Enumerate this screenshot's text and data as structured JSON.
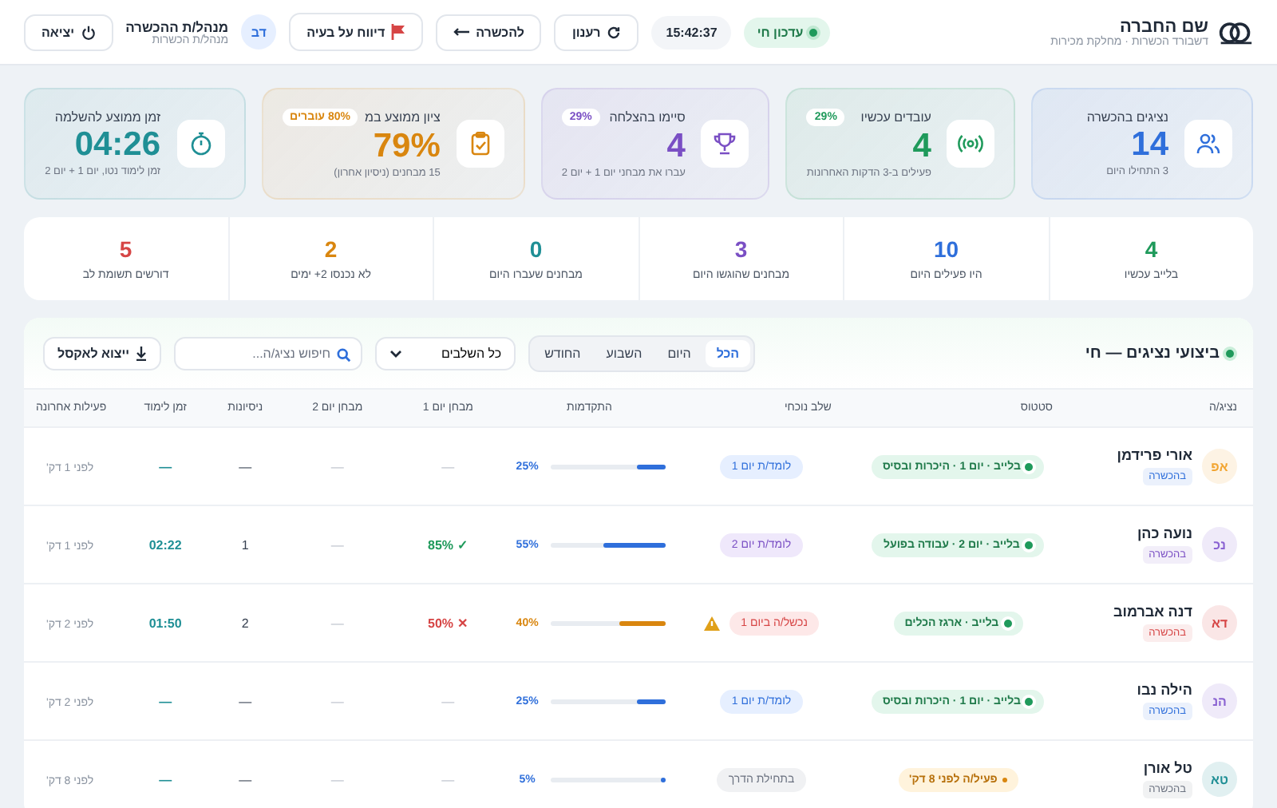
{
  "header": {
    "company": "שם החברה",
    "subtitle": "דשבורד הכשרות · מחלקת מכירות",
    "live_label": "עדכון חי",
    "clock": "15:42:37",
    "refresh": "רענון",
    "to_training": "להכשרה",
    "report": "דיווח על בעיה",
    "user_initials": "דב",
    "user_name": "מנהל/ת ההכשרה",
    "user_role": "מנהל/ת הכשרות",
    "logout": "יציאה"
  },
  "stat_cards": [
    {
      "kind": "people",
      "color": "#2f6fdb",
      "title": "נציגים בהכשרה",
      "value": "14",
      "note": "3 התחילו היום"
    },
    {
      "kind": "signal",
      "color": "#1f9a5b",
      "title": "עובדים עכשיו",
      "value": "4",
      "note": "פעילים ב-3 הדקות האחרונות",
      "badge": "29%"
    },
    {
      "kind": "trophy",
      "color": "#7a4fc4",
      "title": "סיימו בהצלחה",
      "value": "4",
      "note": "עברו את מבחני יום 1 + יום 2",
      "badge": "29%"
    },
    {
      "kind": "clipboard",
      "color": "#d9860f",
      "title": "ציון ממוצע במ",
      "value": "79%",
      "note": "15 מבחנים (ניסיון אחרון)",
      "badge": "80% עוברים"
    },
    {
      "kind": "timer",
      "color": "#1f8f95",
      "title": "זמן ממוצע להשלמה",
      "value": "04:26",
      "note": "זמן לימוד נטו, יום 1 + יום 2"
    }
  ],
  "counters": [
    {
      "value": "4",
      "label": "בלייב עכשיו",
      "color": "#1f9a5b"
    },
    {
      "value": "10",
      "label": "היו פעילים היום",
      "color": "#2f6fdb"
    },
    {
      "value": "3",
      "label": "מבחנים שהוגשו היום",
      "color": "#7a4fc4"
    },
    {
      "value": "0",
      "label": "מבחנים שעברו היום",
      "color": "#1f8f95"
    },
    {
      "value": "2",
      "label": "לא נכנסו 2+ ימים",
      "color": "#d9860f"
    },
    {
      "value": "5",
      "label": "דורשים תשומת לב",
      "color": "#d64545"
    }
  ],
  "table": {
    "title": "ביצועי נציגים — חי",
    "periods": [
      {
        "label": "הכל",
        "selected": true
      },
      {
        "label": "היום",
        "selected": false
      },
      {
        "label": "השבוע",
        "selected": false
      },
      {
        "label": "החודש",
        "selected": false
      }
    ],
    "stage_filter": "כל השלבים",
    "search": {
      "placeholder": "חיפוש נציג/ה..."
    },
    "export": "ייצוא לאקסל",
    "columns": [
      "נציג/ה",
      "סטטוס",
      "שלב נוכחי",
      "התקדמות",
      "מבחן יום 1",
      "מבחן יום 2",
      "ניסיונות",
      "זמן לימוד",
      "פעילות אחרונה"
    ],
    "rows": [
      {
        "initials": "אפ",
        "color": "#f2a531",
        "name": "אורי פרידמן",
        "tag": {
          "text": "בהכשרה",
          "color": "#2f6fdb"
        },
        "status": {
          "kind": "live",
          "text": "בלייב · יום 1 · היכרות ובסיס"
        },
        "stage": {
          "kind": "day1",
          "text": "לומד/ת יום 1"
        },
        "progress": {
          "level": 0.25,
          "text": "25%"
        },
        "test1": {
          "kind": "none",
          "text": "—"
        },
        "test2": {
          "kind": "none",
          "text": "—"
        },
        "attempts": "—",
        "time": "—",
        "last": "לפני 1 דק'"
      },
      {
        "initials": "נכ",
        "color": "#8a63d2",
        "name": "נועה כהן",
        "tag": {
          "text": "בהכשרה",
          "color": "#7a4fc4"
        },
        "status": {
          "kind": "live",
          "text": "בלייב · יום 2 · עבודה בפועל"
        },
        "stage": {
          "kind": "day2",
          "text": "לומד/ת יום 2"
        },
        "progress": {
          "level": 0.55,
          "text": "55%"
        },
        "test1": {
          "kind": "pass",
          "text": "✓ 85%"
        },
        "test2": {
          "kind": "none",
          "text": "—"
        },
        "attempts": "1",
        "time": "02:22",
        "last": "לפני 1 דק'"
      },
      {
        "initials": "דא",
        "color": "#d64545",
        "name": "דנה אברמוב",
        "tag": {
          "text": "בהכשרה",
          "color": "#d64545"
        },
        "status": {
          "kind": "live",
          "text": "בלייב · ארגז הכלים"
        },
        "stage": {
          "kind": "failed",
          "text": "נכשל/ה ביום 1"
        },
        "progress": {
          "level": 0.4,
          "text": "40%"
        },
        "test1": {
          "kind": "fail",
          "text": "✕ 50%"
        },
        "test2": {
          "kind": "none",
          "text": "—"
        },
        "attempts": "2",
        "time": "01:50",
        "last": "לפני 2 דק'"
      },
      {
        "initials": "הנ",
        "color": "#8a63d2",
        "name": "הילה נבו",
        "tag": {
          "text": "בהכשרה",
          "color": "#2f6fdb"
        },
        "status": {
          "kind": "live",
          "text": "בלייב · יום 1 · היכרות ובסיס"
        },
        "stage": {
          "kind": "day1",
          "text": "לומד/ת יום 1"
        },
        "progress": {
          "level": 0.25,
          "text": "25%"
        },
        "test1": {
          "kind": "none",
          "text": "—"
        },
        "test2": {
          "kind": "none",
          "text": "—"
        },
        "attempts": "—",
        "time": "—",
        "last": "לפני 2 דק'"
      },
      {
        "initials": "טא",
        "color": "#1f8f95",
        "name": "טל אורן",
        "tag": {
          "text": "בהכשרה",
          "color": "#6b7280"
        },
        "status": {
          "kind": "idle",
          "text": "פעיל/ה לפני 8 דק'"
        },
        "stage": {
          "kind": "start",
          "text": "בתחילת הדרך"
        },
        "progress": {
          "level": 0.05,
          "text": "5%"
        },
        "test1": {
          "kind": "none",
          "text": "—"
        },
        "test2": {
          "kind": "none",
          "text": "—"
        },
        "attempts": "—",
        "time": "—",
        "last": "לפני 8 דק'"
      }
    ]
  }
}
